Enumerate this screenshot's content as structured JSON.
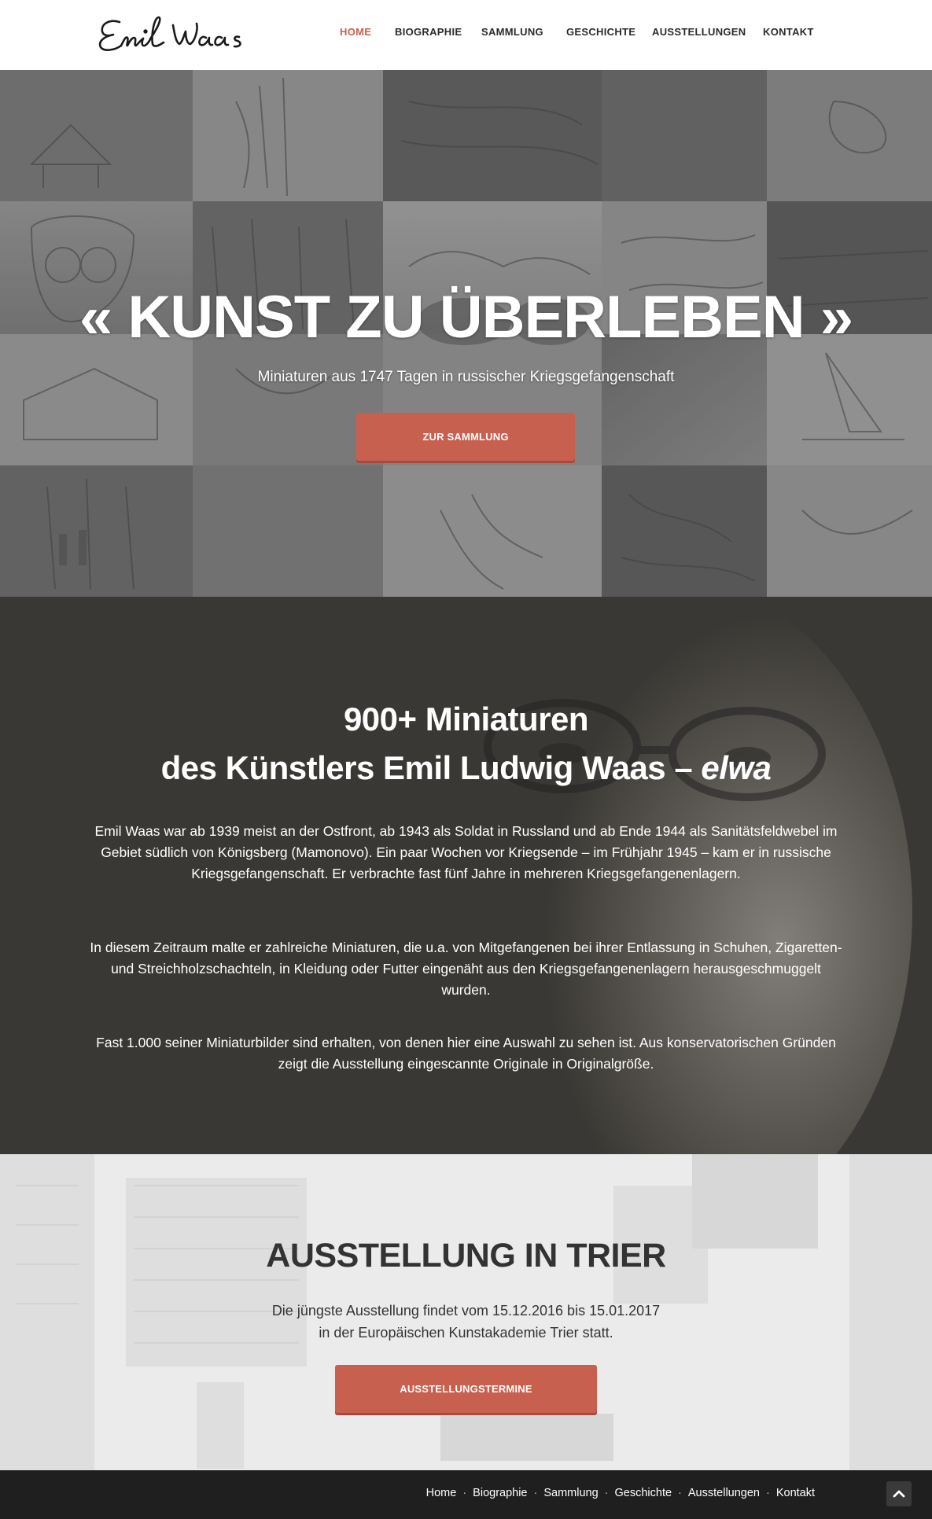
{
  "header": {
    "logo_text": "Emil Waas",
    "nav": [
      {
        "label": "HOME",
        "active": true
      },
      {
        "label": "BIOGRAPHIE",
        "active": false
      },
      {
        "label": "SAMMLUNG",
        "active": false
      },
      {
        "label": "GESCHICHTE",
        "active": false
      },
      {
        "label": "AUSSTELLUNGEN",
        "active": false
      },
      {
        "label": "KONTAKT",
        "active": false
      }
    ]
  },
  "hero": {
    "title": "« KUNST ZU ÜBERLEBEN »",
    "subtitle": "Miniaturen aus 1747 Tagen in russischer Kriegsgefangenschaft",
    "button": "ZUR SAMMLUNG"
  },
  "intro": {
    "title_line1": "900+ Miniaturen",
    "title_line2": "des Künstlers Emil Ludwig Waas – ",
    "title_em": "elwa",
    "paragraphs": [
      "Emil Waas war ab 1939 meist an der Ostfront, ab 1943 als Soldat in Russland und ab Ende 1944 als Sanitätsfeldwebel im Gebiet südlich von Königsberg (Mamonovo). Ein paar Wochen vor Kriegsende – im Frühjahr 1945 – kam er in russische Kriegsgefangenschaft. Er verbrachte fast fünf Jahre in mehreren Kriegsgefangenenlagern.",
      "In diesem Zeitraum malte er zahlreiche Miniaturen, die u.a. von Mitgefangenen bei ihrer Entlassung in Schuhen, Zigaretten- und Streichholzschachteln, in Kleidung oder Futter eingenäht aus den Kriegsgefangenenlagern herausgeschmuggelt wurden.",
      "Fast 1.000 seiner Miniaturbilder sind erhalten, von denen hier eine Auswahl zu sehen ist. Aus konservatorischen Gründen zeigt die Ausstellung eingescannte Originale in Originalgröße."
    ]
  },
  "exhibition": {
    "title": "AUSSTELLUNG IN TRIER",
    "text_line1": "Die jüngste Ausstellung findet vom 15.12.2016 bis 15.01.2017",
    "text_line2": "in der Europäischen Kunstakademie Trier statt.",
    "button": "AUSSTELLUNGSTERMINE"
  },
  "footer": {
    "nav": [
      "Home",
      "Biographie",
      "Sammlung",
      "Geschichte",
      "Ausstellungen",
      "Kontakt"
    ],
    "separator": "·",
    "back_to_top_icon": "chevron-up-icon"
  },
  "colors": {
    "accent": "#c8604f",
    "footer_bg": "#1f1f1f",
    "intro_bg": "#3a3834"
  }
}
